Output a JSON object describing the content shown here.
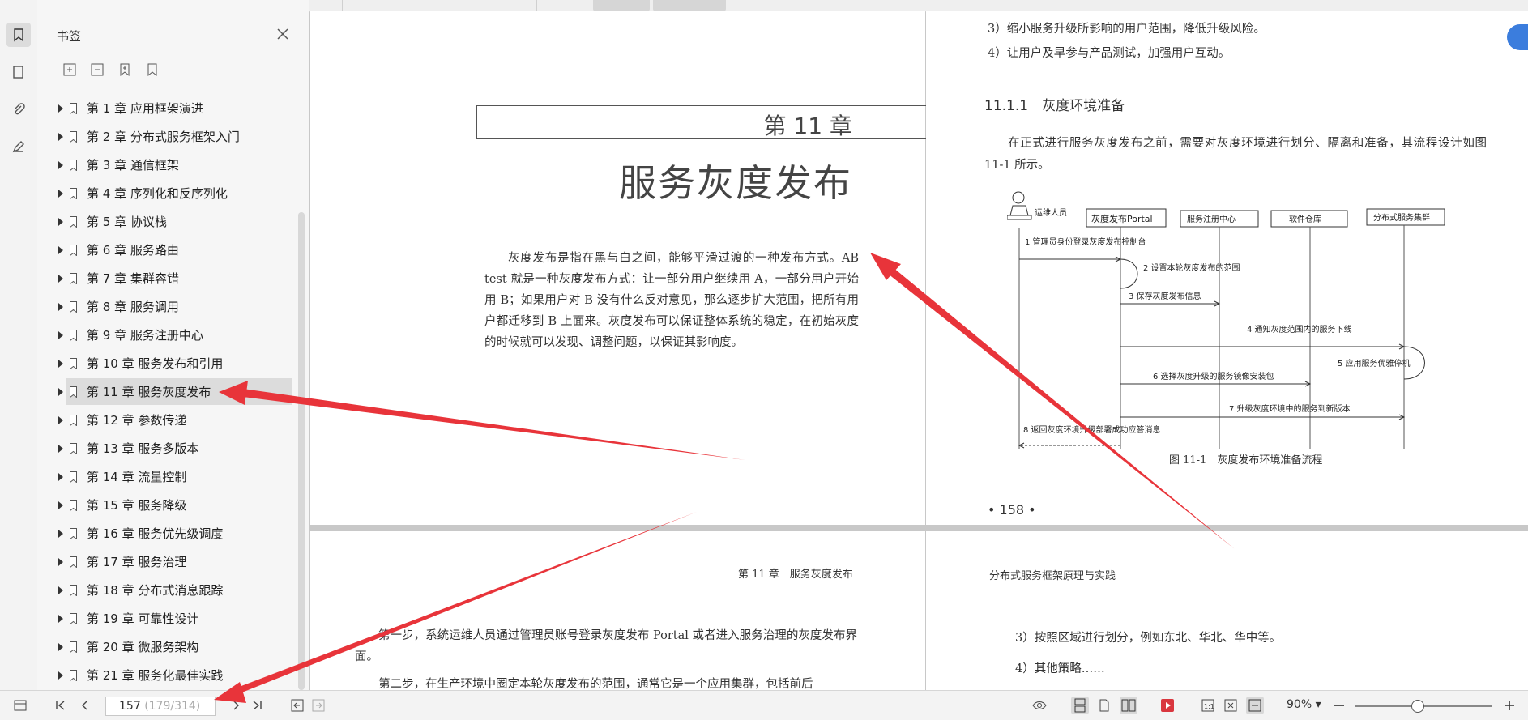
{
  "panel": {
    "title": "书签",
    "items": [
      {
        "label": "第 1 章 应用框架演进"
      },
      {
        "label": "第 2 章 分布式服务框架入门"
      },
      {
        "label": "第 3 章 通信框架"
      },
      {
        "label": "第 4 章 序列化和反序列化"
      },
      {
        "label": "第 5 章 协议栈"
      },
      {
        "label": "第 6 章 服务路由"
      },
      {
        "label": "第 7 章 集群容错"
      },
      {
        "label": "第 8 章 服务调用"
      },
      {
        "label": "第 9 章 服务注册中心"
      },
      {
        "label": "第 10 章 服务发布和引用"
      },
      {
        "label": "第 11 章 服务灰度发布",
        "selected": true
      },
      {
        "label": "第 12 章 参数传递"
      },
      {
        "label": "第 13 章 服务多版本"
      },
      {
        "label": "第 14 章 流量控制"
      },
      {
        "label": "第 15 章 服务降级"
      },
      {
        "label": "第 16 章 服务优先级调度"
      },
      {
        "label": "第 17 章 服务治理"
      },
      {
        "label": "第 18 章 分布式消息跟踪"
      },
      {
        "label": "第 19 章 可靠性设计"
      },
      {
        "label": "第 20 章 微服务架构"
      },
      {
        "label": "第 21 章 服务化最佳实践"
      }
    ]
  },
  "page157": {
    "chapter_number": "第 11 章",
    "chapter_title": "服务灰度发布",
    "intro": "灰度发布是指在黑与白之间，能够平滑过渡的一种发布方式。AB test 就是一种灰度发布方式：让一部分用户继续用 A，一部分用户开始用 B；如果用户对 B 没有什么反对意见，那么逐步扩大范围，把所有用户都迁移到 B 上面来。灰度发布可以保证整体系统的稳定，在初始灰度的时候就可以发现、调整问题，以保证其影响度。"
  },
  "page158": {
    "line3": "3）缩小服务升级所影响的用户范围，降低升级风险。",
    "line4": "4）让用户及早参与产品测试，加强用户互动。",
    "section": "11.1.1　灰度环境准备",
    "para": "在正式进行服务灰度发布之前，需要对灰度环境进行划分、隔离和准备，其流程设计如图 11-1 所示。",
    "figure_caption": "图 11-1　灰度发布环境准备流程",
    "page_number": "• 158 •",
    "diagram": {
      "actors": [
        "运维人员",
        "灰度发布Portal",
        "服务注册中心",
        "软件仓库",
        "分布式服务集群"
      ],
      "steps": [
        "1 管理员身份登录灰度发布控制台",
        "2 设置本轮灰度发布的范围",
        "3 保存灰度发布信息",
        "4 通知灰度范围内的服务下线",
        "5 应用服务优雅停机",
        "6 选择灰度升级的服务镜像安装包",
        "7 升级灰度环境中的服务到新版本",
        "8 返回灰度环境升级部署成功应答消息"
      ]
    }
  },
  "page159": {
    "running_head": "第 11 章　服务灰度发布",
    "para1": "第一步，系统运维人员通过管理员账号登录灰度发布 Portal 或者进入服务治理的灰度发布界面。",
    "para2": "第二步，在生产环境中圈定本轮灰度发布的范围，通常它是一个应用集群，包括前后"
  },
  "page160": {
    "running_head": "分布式服务框架原理与实践",
    "line3": "3）按照区域进行划分，例如东北、华北、华中等。",
    "line4": "4）其他策略……"
  },
  "status": {
    "current_page": "157",
    "page_total": "(179/314)",
    "zoom": "90%",
    "zoom_level": 0.45
  }
}
